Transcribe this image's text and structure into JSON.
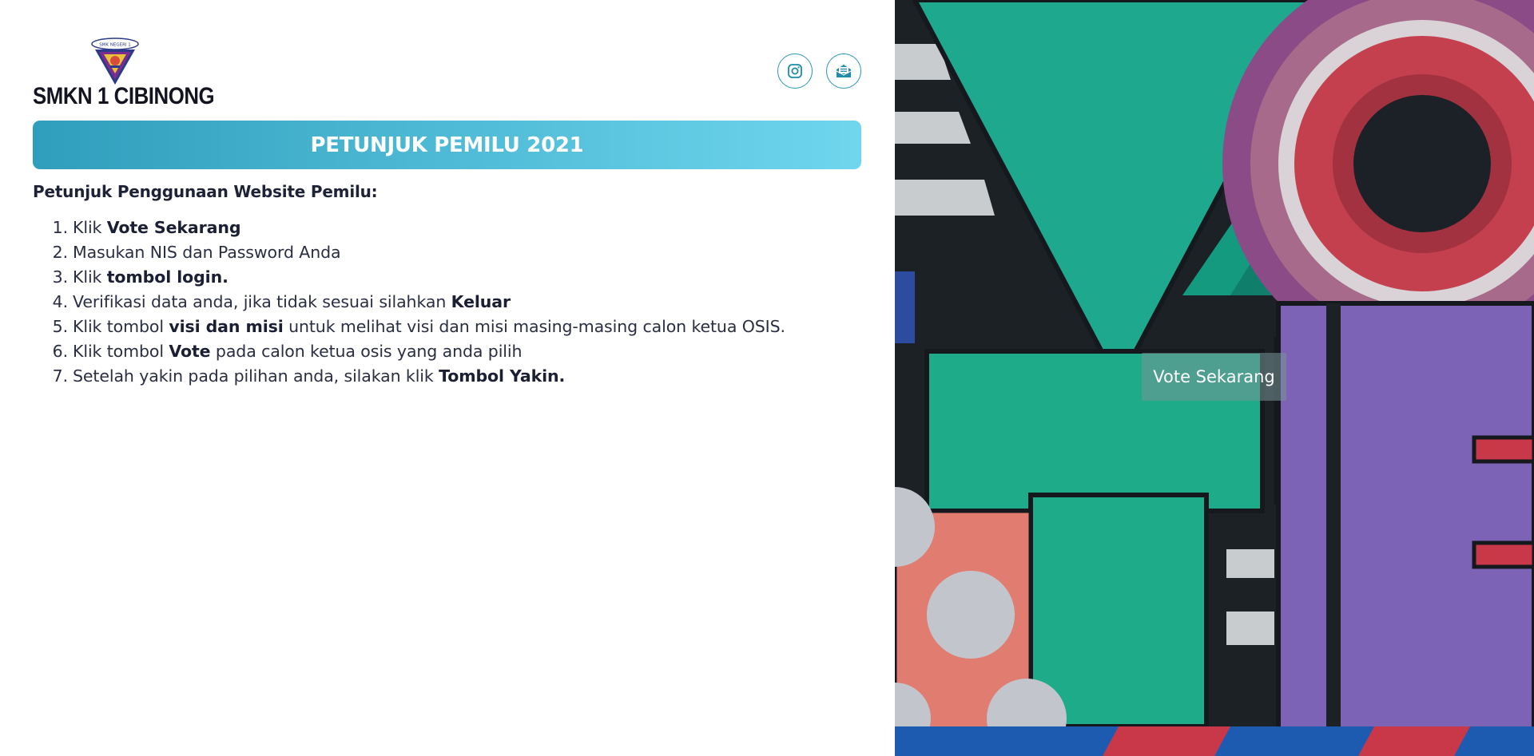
{
  "header": {
    "logo_icon": "school-crest-icon",
    "logo_text": "SMK NEGERI 1",
    "school_name": "SMKN 1 CIBINONG",
    "social": [
      {
        "icon": "instagram-icon"
      },
      {
        "icon": "mail-icon"
      }
    ]
  },
  "banner": {
    "title": "PETUNJUK PEMILU 2021",
    "gradient": [
      "#2f9ebc",
      "#6fd6ee"
    ]
  },
  "instructions": {
    "heading": "Petunjuk Penggunaan Website Pemilu:",
    "steps": [
      {
        "num": "1.",
        "pre": "Klik ",
        "bold": "Vote Sekarang",
        "post": ""
      },
      {
        "num": "2.",
        "pre": "Masukan NIS dan Password Anda",
        "bold": "",
        "post": ""
      },
      {
        "num": "3.",
        "pre": "Klik ",
        "bold": "tombol login.",
        "post": ""
      },
      {
        "num": "4.",
        "pre": "Verifikasi data anda, jika tidak sesuai silahkan ",
        "bold": "Keluar",
        "post": ""
      },
      {
        "num": "5.",
        "pre": "Klik tombol ",
        "bold": "visi dan misi",
        "post": " untuk melihat visi dan misi masing-masing calon ketua OSIS."
      },
      {
        "num": "6.",
        "pre": "Klik tombol ",
        "bold": "Vote",
        "post": " pada calon ketua osis yang anda pilih"
      },
      {
        "num": "7.",
        "pre": "Setelah yakin pada pilihan anda, silakan klik ",
        "bold": "Tombol Yakin.",
        "post": ""
      }
    ]
  },
  "hero": {
    "cta_label": "Vote Sekarang",
    "colors": {
      "teal": "#1eab8a",
      "teal_dark": "#18977b",
      "purple": "#7d63b6",
      "red": "#c83848",
      "salmon": "#e27d72",
      "blue": "#1e63b8"
    }
  }
}
